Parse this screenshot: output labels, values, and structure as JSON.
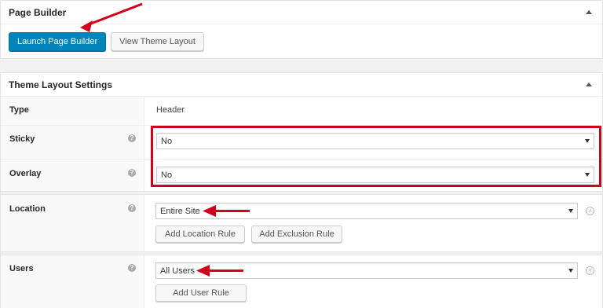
{
  "page_builder": {
    "title": "Page Builder",
    "launch_label": "Launch Page Builder",
    "view_layout_label": "View Theme Layout"
  },
  "theme_layout": {
    "title": "Theme Layout Settings",
    "type": {
      "label": "Type",
      "value": "Header"
    },
    "sticky": {
      "label": "Sticky",
      "value": "No"
    },
    "overlay": {
      "label": "Overlay",
      "value": "No"
    },
    "location": {
      "label": "Location",
      "value": "Entire Site",
      "add_location_label": "Add Location Rule",
      "add_exclusion_label": "Add Exclusion Rule"
    },
    "users": {
      "label": "Users",
      "value": "All Users",
      "add_user_label": "Add User Rule"
    }
  },
  "icons": {
    "help": "help-icon",
    "remove": "remove-icon",
    "collapse": "collapse-arrow-icon"
  },
  "colors": {
    "primary_button": "#0085ba",
    "annotation_red": "#d0021b"
  }
}
